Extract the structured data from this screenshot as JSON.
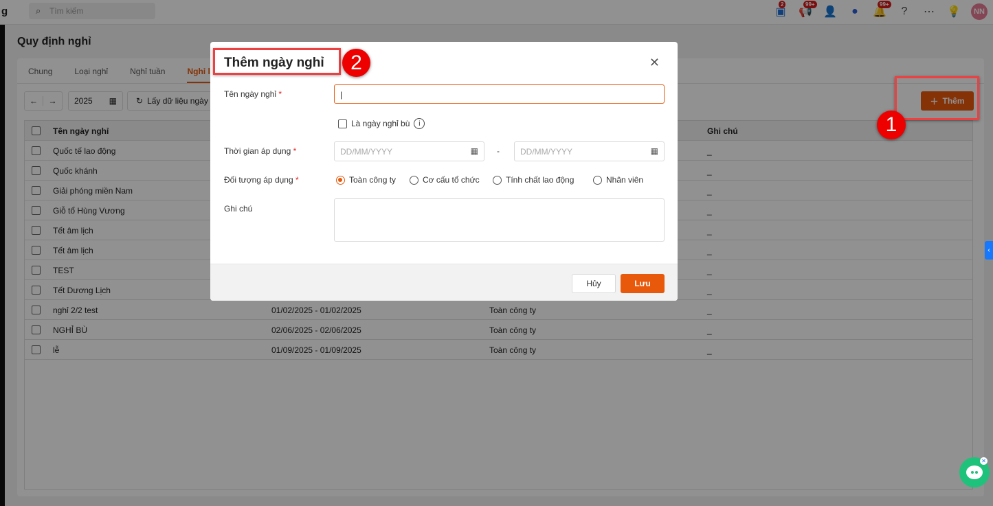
{
  "topbar": {
    "brand": "g",
    "search_placeholder": "Tìm kiếm",
    "cart_badge": "2",
    "announce_badge": "99+",
    "notif_badge": "99+",
    "avatar": "NN"
  },
  "page": {
    "title": "Quy định nghỉ",
    "tabs": [
      "Chung",
      "Loại nghỉ",
      "Nghỉ tuần",
      "Nghỉ lễ"
    ],
    "year": "2025",
    "fetch_label": "Lấy dữ liệu ngày",
    "add_label": "Thêm"
  },
  "table": {
    "headers": {
      "name": "Tên ngày nghỉ",
      "note": "Ghi chú"
    },
    "rows": [
      {
        "name": "Quốc tế lao động",
        "date": "",
        "object": "",
        "note": "_"
      },
      {
        "name": "Quốc khánh",
        "date": "",
        "object": "",
        "note": "_"
      },
      {
        "name": "Giải phóng miền Nam",
        "date": "",
        "object": "",
        "note": "_"
      },
      {
        "name": "Giỗ tổ Hùng Vương",
        "date": "",
        "object": "",
        "note": "_"
      },
      {
        "name": "Tết âm lịch",
        "date": "",
        "object": "",
        "note": "_"
      },
      {
        "name": "Tết âm lịch",
        "date": "",
        "object": "",
        "note": "_"
      },
      {
        "name": "TEST",
        "date": "",
        "object": "",
        "note": "_"
      },
      {
        "name": "Tết Dương Lịch",
        "date": "",
        "object": "",
        "note": "_"
      },
      {
        "name": "nghỉ 2/2 test",
        "date": "01/02/2025 - 01/02/2025",
        "object": "Toàn công ty",
        "note": "_"
      },
      {
        "name": "NGHỈ BÙ",
        "date": "02/06/2025 - 02/06/2025",
        "object": "Toàn công ty",
        "note": "_"
      },
      {
        "name": "lễ",
        "date": "01/09/2025 - 01/09/2025",
        "object": "Toàn công ty",
        "note": "_"
      }
    ]
  },
  "modal": {
    "title": "Thêm ngày nghỉ",
    "name_label": "Tên ngày nghỉ",
    "name_value": "",
    "compensatory_label": "Là ngày nghỉ bù",
    "time_label": "Thời gian áp dụng",
    "date_placeholder": "DD/MM/YYYY",
    "dash": "-",
    "object_label": "Đối tượng áp dụng",
    "options": [
      "Toàn công ty",
      "Cơ cấu tổ chức",
      "Tính chất lao động",
      "Nhân viên"
    ],
    "selected_option": "Toàn công ty",
    "note_label": "Ghi chú",
    "required_mark": "*",
    "cancel": "Hủy",
    "save": "Lưu"
  },
  "annotations": [
    "1",
    "2"
  ],
  "colors": {
    "accent": "#e8590c",
    "annotation": "#ee0000"
  }
}
